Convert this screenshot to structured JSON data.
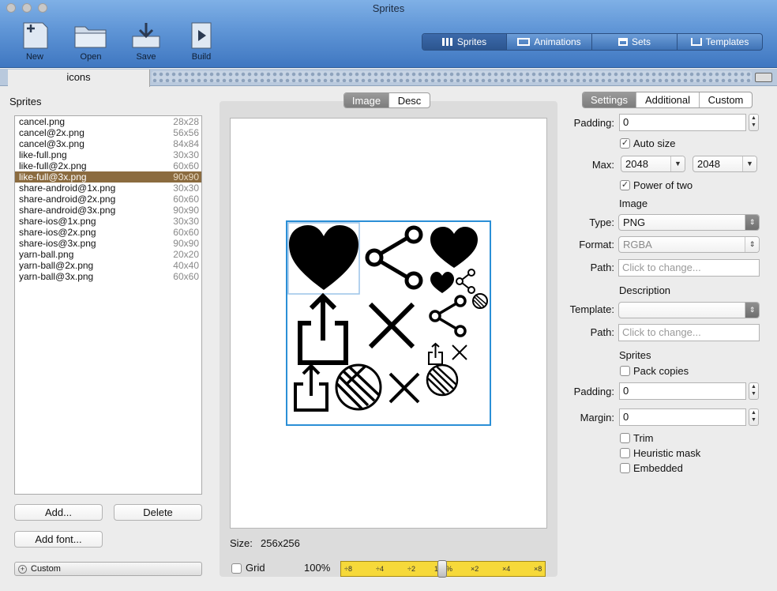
{
  "window": {
    "title": "Sprites"
  },
  "toolbar": {
    "new_label": "New",
    "open_label": "Open",
    "save_label": "Save",
    "build_label": "Build",
    "modes": [
      {
        "label": "Sprites",
        "icon": "grid-icon"
      },
      {
        "label": "Animations",
        "icon": "film-icon"
      },
      {
        "label": "Sets",
        "icon": "stack-icon"
      },
      {
        "label": "Templates",
        "icon": "tray-icon"
      }
    ]
  },
  "doc_tab": {
    "label": "icons"
  },
  "left": {
    "title": "Sprites",
    "items": [
      {
        "name": "cancel.png",
        "size": "28x28"
      },
      {
        "name": "cancel@2x.png",
        "size": "56x56"
      },
      {
        "name": "cancel@3x.png",
        "size": "84x84"
      },
      {
        "name": "like-full.png",
        "size": "30x30"
      },
      {
        "name": "like-full@2x.png",
        "size": "60x60"
      },
      {
        "name": "like-full@3x.png",
        "size": "90x90"
      },
      {
        "name": "share-android@1x.png",
        "size": "30x30"
      },
      {
        "name": "share-android@2x.png",
        "size": "60x60"
      },
      {
        "name": "share-android@3x.png",
        "size": "90x90"
      },
      {
        "name": "share-ios@1x.png",
        "size": "30x30"
      },
      {
        "name": "share-ios@2x.png",
        "size": "60x60"
      },
      {
        "name": "share-ios@3x.png",
        "size": "90x90"
      },
      {
        "name": "yarn-ball.png",
        "size": "20x20"
      },
      {
        "name": "yarn-ball@2x.png",
        "size": "40x40"
      },
      {
        "name": "yarn-ball@3x.png",
        "size": "60x60"
      }
    ],
    "selected_index": 5,
    "add_label": "Add...",
    "delete_label": "Delete",
    "add_font_label": "Add font...",
    "custom_label": "Custom"
  },
  "center": {
    "tabs": [
      "Image",
      "Desc"
    ],
    "size_label": "Size:",
    "size_value": "256x256",
    "grid_label": "Grid",
    "zoom_value": "100%",
    "zoom_ticks": [
      "÷8",
      "÷4",
      "÷2",
      "100%",
      "×2",
      "×4",
      "×8"
    ]
  },
  "right": {
    "tabs": [
      "Settings",
      "Additional",
      "Custom"
    ],
    "padding_label": "Padding:",
    "padding_value": "0",
    "auto_size_label": "Auto size",
    "max_label": "Max:",
    "max_w": "2048",
    "max_h": "2048",
    "power_two_label": "Power of two",
    "image_section": "Image",
    "type_label": "Type:",
    "type_value": "PNG",
    "format_label": "Format:",
    "format_value": "RGBA",
    "path_label": "Path:",
    "path_placeholder": "Click to change...",
    "desc_section": "Description",
    "template_label": "Template:",
    "template_value": "",
    "desc_path_label": "Path:",
    "desc_path_placeholder": "Click to change...",
    "sprites_section": "Sprites",
    "pack_copies_label": "Pack copies",
    "sprites_padding_label": "Padding:",
    "sprites_padding_value": "0",
    "margin_label": "Margin:",
    "margin_value": "0",
    "trim_label": "Trim",
    "heuristic_label": "Heuristic mask",
    "embedded_label": "Embedded",
    "checkmark": "✓"
  },
  "colors": {
    "accent": "#2b8fd6",
    "selection": "#8b6b3f",
    "ruler": "#f6d93a"
  }
}
